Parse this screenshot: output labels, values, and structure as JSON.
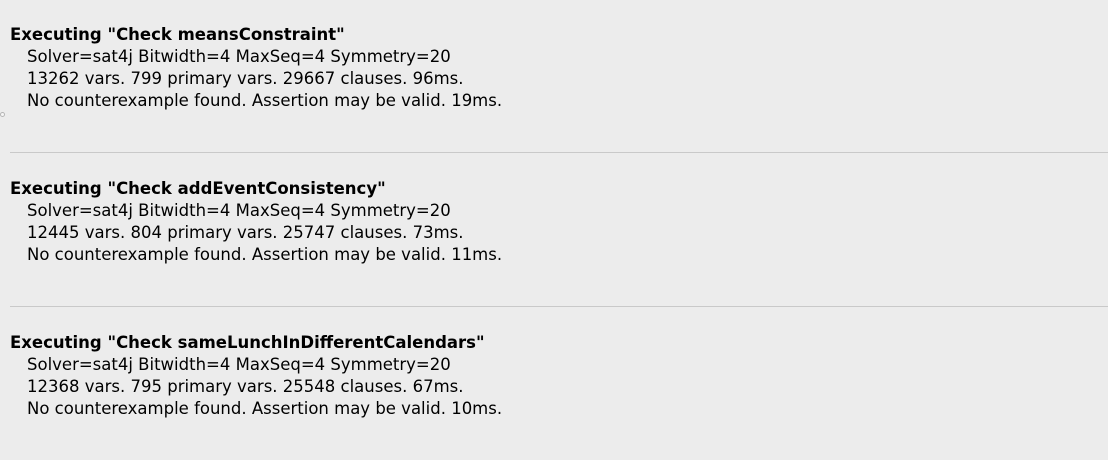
{
  "log": {
    "entries": [
      {
        "title": "Executing \"Check meansConstraint\"",
        "lines": [
          "Solver=sat4j Bitwidth=4 MaxSeq=4 Symmetry=20",
          "13262 vars. 799 primary vars. 29667 clauses. 96ms.",
          "No counterexample found. Assertion may be valid. 19ms."
        ]
      },
      {
        "title": "Executing \"Check addEventConsistency\"",
        "lines": [
          "Solver=sat4j Bitwidth=4 MaxSeq=4 Symmetry=20",
          "12445 vars. 804 primary vars. 25747 clauses. 73ms.",
          "No counterexample found. Assertion may be valid. 11ms."
        ]
      },
      {
        "title": "Executing \"Check sameLunchInDifferentCalendars\"",
        "lines": [
          "Solver=sat4j Bitwidth=4 MaxSeq=4 Symmetry=20",
          "12368 vars. 795 primary vars. 25548 clauses. 67ms.",
          "No counterexample found. Assertion may be valid. 10ms."
        ]
      }
    ]
  }
}
